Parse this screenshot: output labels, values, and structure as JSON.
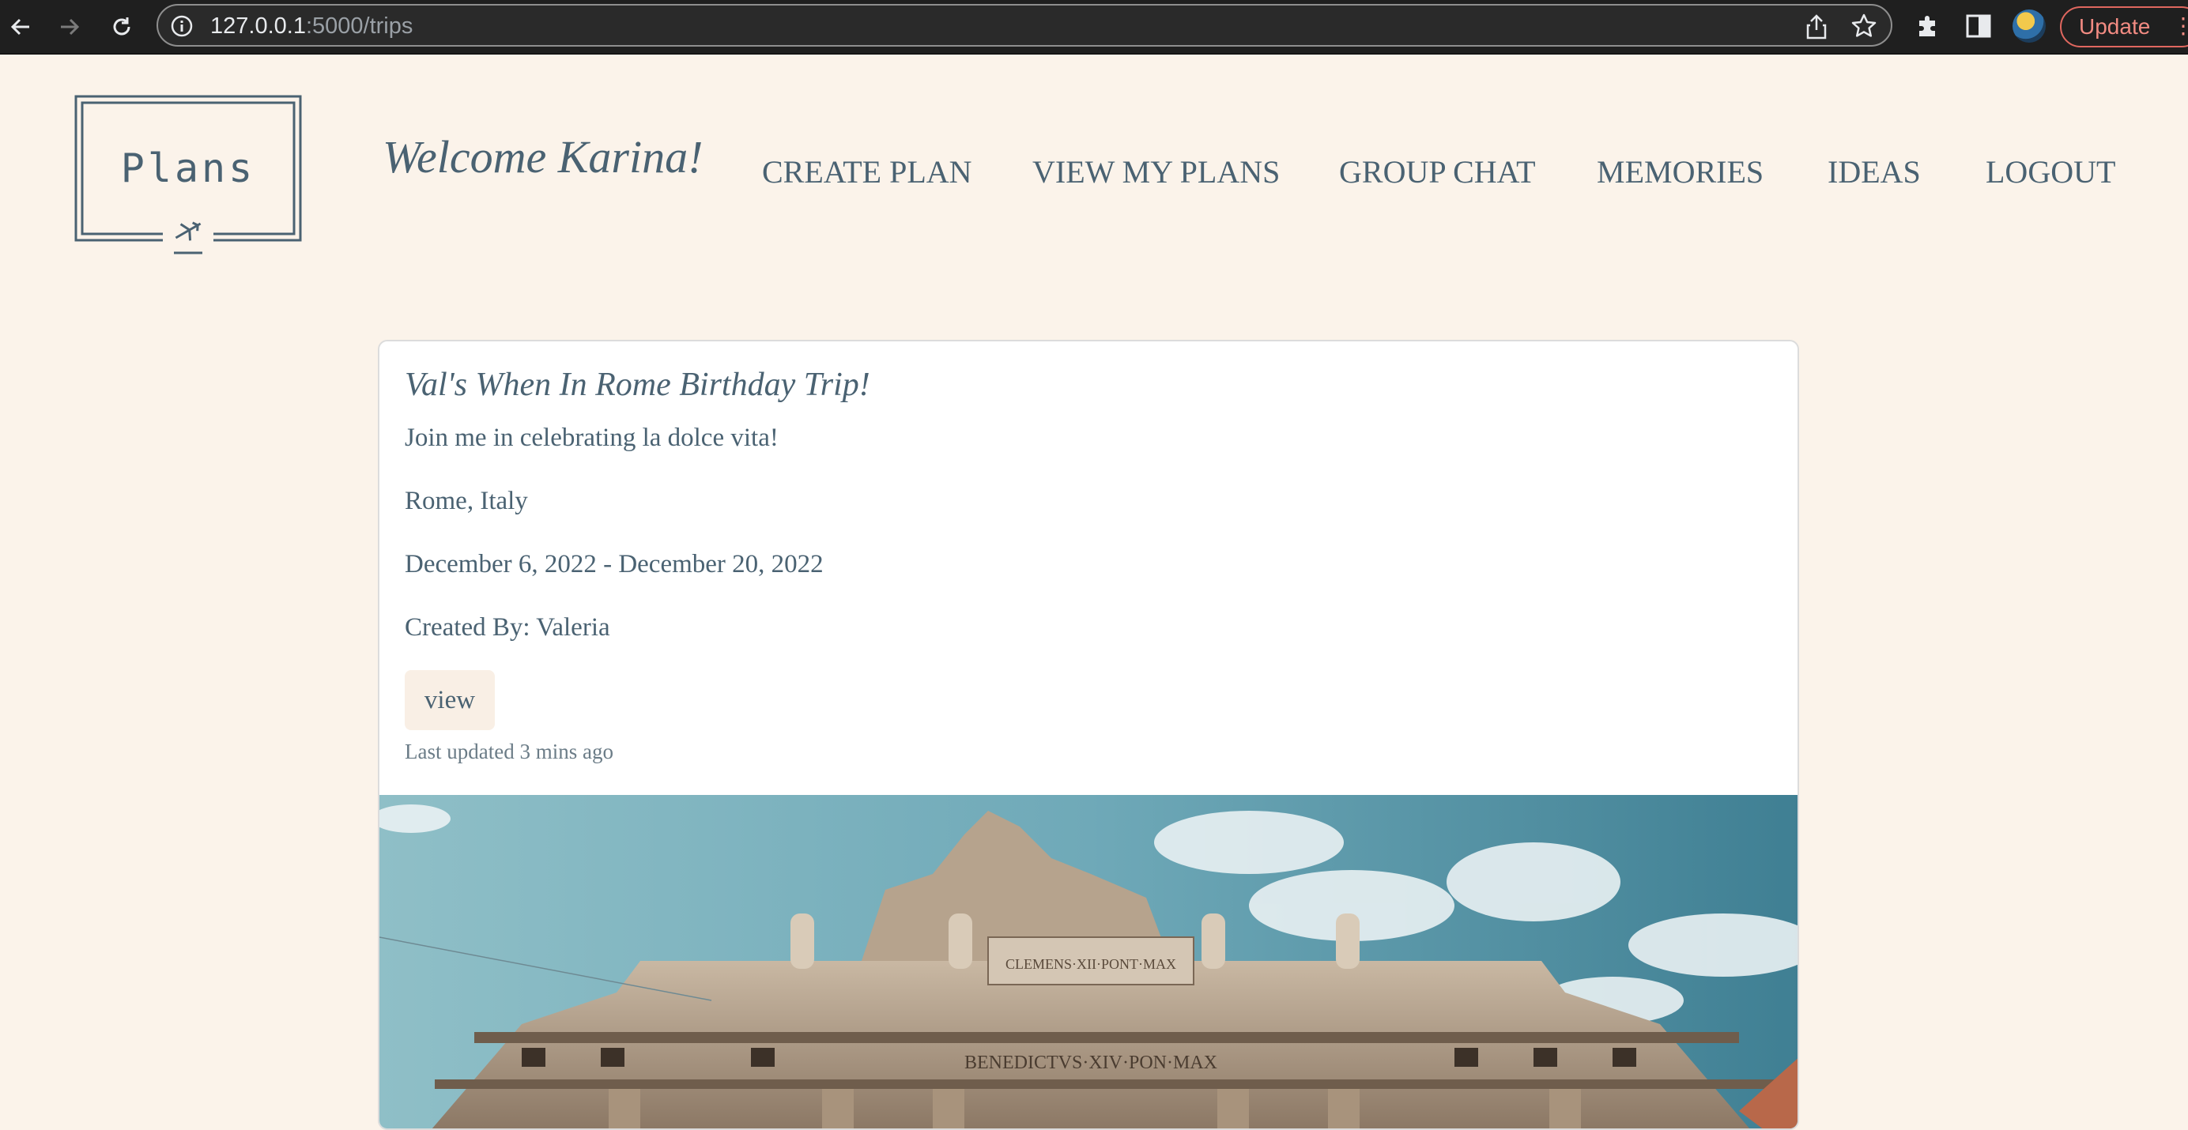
{
  "browser": {
    "url_host": "127.0.0.1",
    "url_rest": ":5000/trips",
    "update_label": "Update"
  },
  "header": {
    "logo_text": "Plans",
    "welcome": "Welcome Karina!",
    "nav": [
      "CREATE PLAN",
      "VIEW MY PLANS",
      "GROUP CHAT",
      "MEMORIES",
      "IDEAS",
      "LOGOUT"
    ]
  },
  "trip": {
    "title": "Val's When In Rome Birthday Trip!",
    "description": "Join me in celebrating la dolce vita!",
    "location": "Rome, Italy",
    "dates": "December 6, 2022 - December 20, 2022",
    "created_by": "Created By: Valeria",
    "view_label": "view",
    "updated": "Last updated 3 mins ago",
    "image_inscription_1": "CLEMENS·XII·PONT·MAX",
    "image_inscription_2": "BENEDICTVS·XIV·PON·MAX"
  },
  "colors": {
    "page_bg": "#fbf3ea",
    "text": "#4a6272",
    "chrome_bg": "#1f1f1f",
    "update_accent": "#f28b82",
    "button_bg": "#f9efe5"
  }
}
